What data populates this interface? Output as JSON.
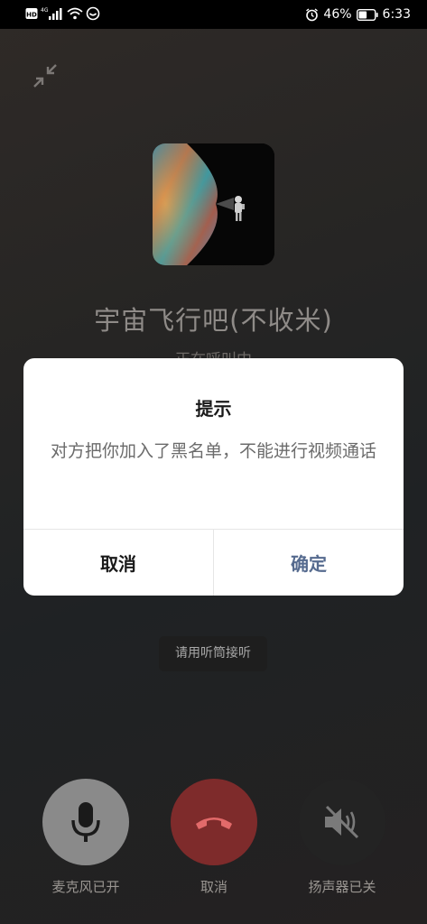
{
  "status_bar": {
    "network_hd": "HD",
    "network_type": "4G",
    "battery_percent": "46%",
    "time": "6:33",
    "icons": [
      "hd-icon",
      "signal-icon",
      "wifi-icon",
      "hotspot-icon",
      "alarm-icon",
      "battery-icon"
    ]
  },
  "call": {
    "contact_name": "宇宙飞行吧(不收米)",
    "status_text": "正在呼叫中",
    "earpiece_tip": "请用听筒接听",
    "controls": [
      {
        "label": "麦克风已开",
        "icon": "microphone-icon",
        "color": "#8a8a8a"
      },
      {
        "label": "取消",
        "icon": "hangup-icon",
        "color": "#7e2b2b"
      },
      {
        "label": "扬声器已关",
        "icon": "speaker-muted-icon",
        "color": "#232323"
      }
    ]
  },
  "dialog": {
    "title": "提示",
    "message": "对方把你加入了黑名单，不能进行视频通话",
    "cancel_label": "取消",
    "confirm_label": "确定",
    "confirm_color": "#566b8f"
  }
}
